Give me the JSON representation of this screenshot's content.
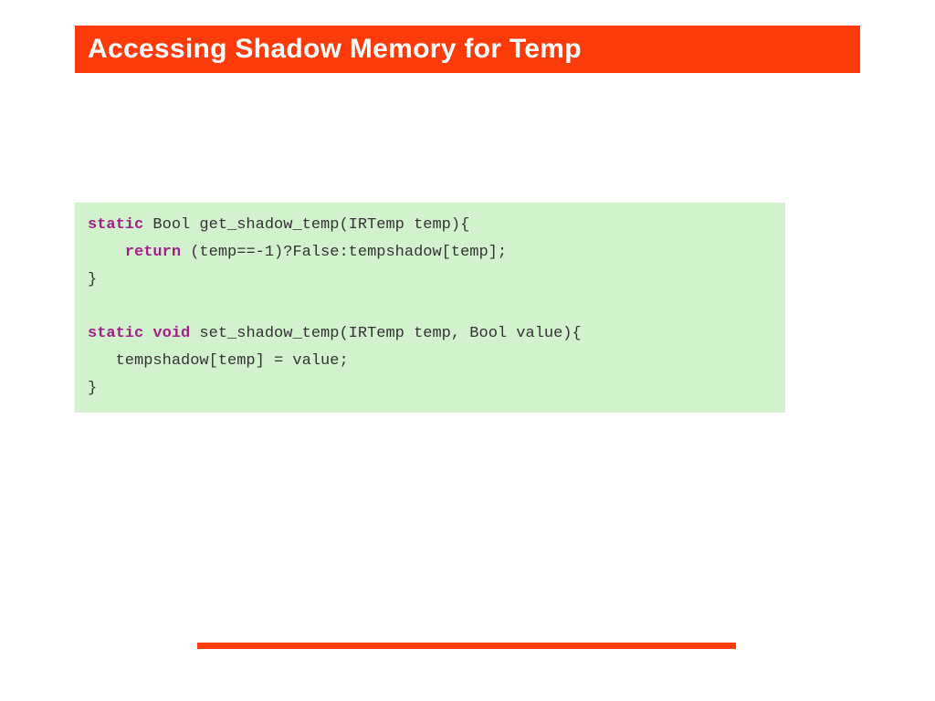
{
  "title": "Accessing Shadow Memory for Temp",
  "code": {
    "kw_static1": "static",
    "fn1_sig": " Bool get_shadow_temp(IRTemp temp){",
    "kw_return": "return",
    "fn1_body": " (temp==-1)?False:tempshadow[temp];",
    "close1": "}",
    "blank": "",
    "kw_static2": "static",
    "kw_void": " void",
    "fn2_sig": " set_shadow_temp(IRTemp temp, Bool value){",
    "fn2_body": "   tempshadow[temp] = value;",
    "close2": "}"
  },
  "colors": {
    "accent": "#fb3c0a",
    "code_bg": "#d2f2cd",
    "keyword": "#a31f8a"
  }
}
